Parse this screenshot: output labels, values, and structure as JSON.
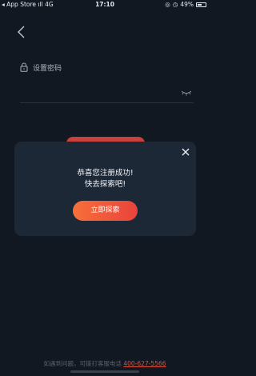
{
  "status_bar": {
    "carrier": "App Store",
    "network": "4G",
    "time": "17:10",
    "battery": "49%"
  },
  "form": {
    "password_label": "设置密码"
  },
  "modal": {
    "line1": "恭喜您注册成功!",
    "line2": "快去探索吧!",
    "button_label": "立即探索"
  },
  "footer": {
    "text": "如遇到问题，可拨打客服电话 ",
    "phone": "400-627-5566"
  },
  "colors": {
    "background": "#121821",
    "modal": "#1d2837",
    "accent": "#e9433c"
  }
}
